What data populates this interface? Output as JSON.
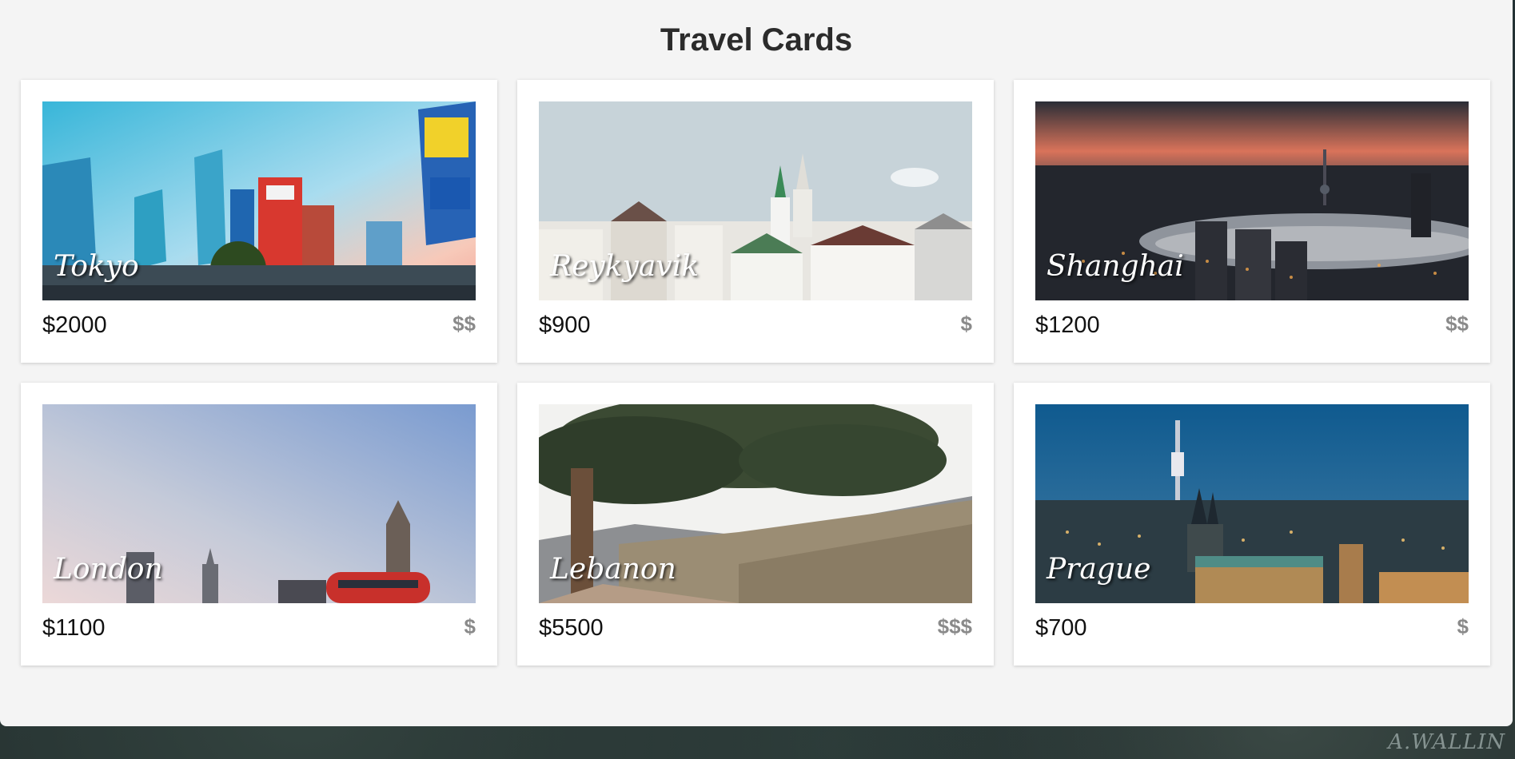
{
  "page": {
    "title": "Travel Cards",
    "signature": "A.WALLIN"
  },
  "cards": [
    {
      "city": "Tokyo",
      "price": "$2000",
      "cost": "$$"
    },
    {
      "city": "Reykyavik",
      "price": "$900",
      "cost": "$"
    },
    {
      "city": "Shanghai",
      "price": "$1200",
      "cost": "$$"
    },
    {
      "city": "London",
      "price": "$1100",
      "cost": "$"
    },
    {
      "city": "Lebanon",
      "price": "$5500",
      "cost": "$$$"
    },
    {
      "city": "Prague",
      "price": "$700",
      "cost": "$"
    }
  ]
}
